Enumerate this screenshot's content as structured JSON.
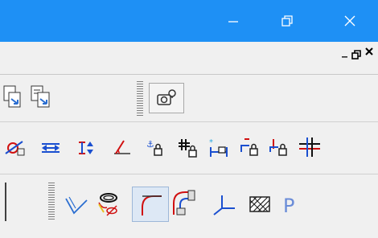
{
  "window": {
    "controls": {
      "minimize_icon": "minimize-icon",
      "restore_icon": "restore-icon",
      "close_icon": "close-icon"
    },
    "accent_color": "#1e90f5"
  },
  "mdi_controls": {
    "minimize": "_",
    "restore": "restore-icon",
    "close": "x"
  },
  "toolbars": {
    "row1": [
      "layer-move-icon",
      "layer-copy-icon",
      "camera-settings-icon"
    ],
    "row2": [
      "tangent-constraint-icon",
      "horizontal-constraint-icon",
      "vertical-constraint-icon",
      "angle-constraint-icon",
      "lock-point-icon",
      "lock-cross-icon",
      "lock-distance-icon",
      "lock-red-icon",
      "lock-blue-icon",
      "lock-combined-icon"
    ],
    "row3": [
      "parallel-line-icon",
      "hole-thread-icon",
      "fillet-icon",
      "pipe-bend-icon",
      "branch-icon",
      "hatch-icon",
      "p-icon"
    ]
  },
  "p_icon_text": "P"
}
